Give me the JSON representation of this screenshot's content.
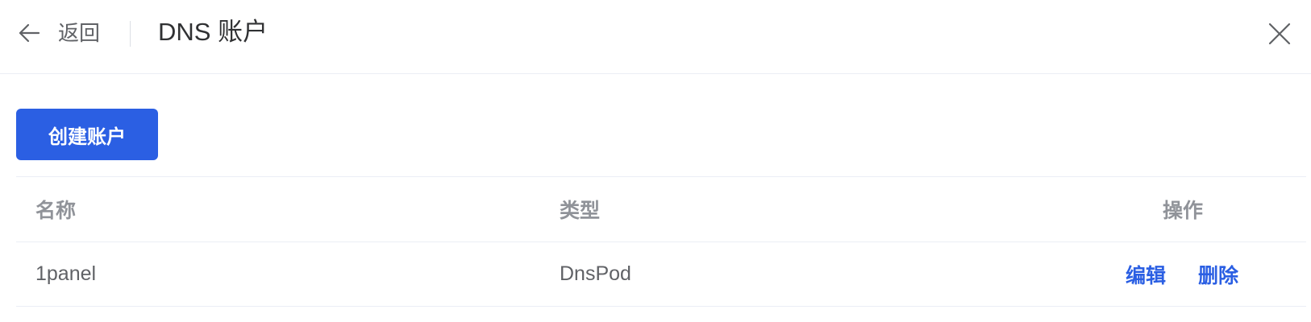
{
  "header": {
    "back_label": "返回",
    "title": "DNS 账户",
    "icons": [
      "arrow-left-icon",
      "close-icon"
    ]
  },
  "toolbar": {
    "create_label": "创建账户",
    "accent_color": "#2b5fe3"
  },
  "table": {
    "columns": [
      "名称",
      "类型",
      "操作"
    ],
    "rows": [
      {
        "name": "1panel",
        "type": "DnsPod",
        "actions": [
          "编辑",
          "删除"
        ]
      }
    ]
  }
}
